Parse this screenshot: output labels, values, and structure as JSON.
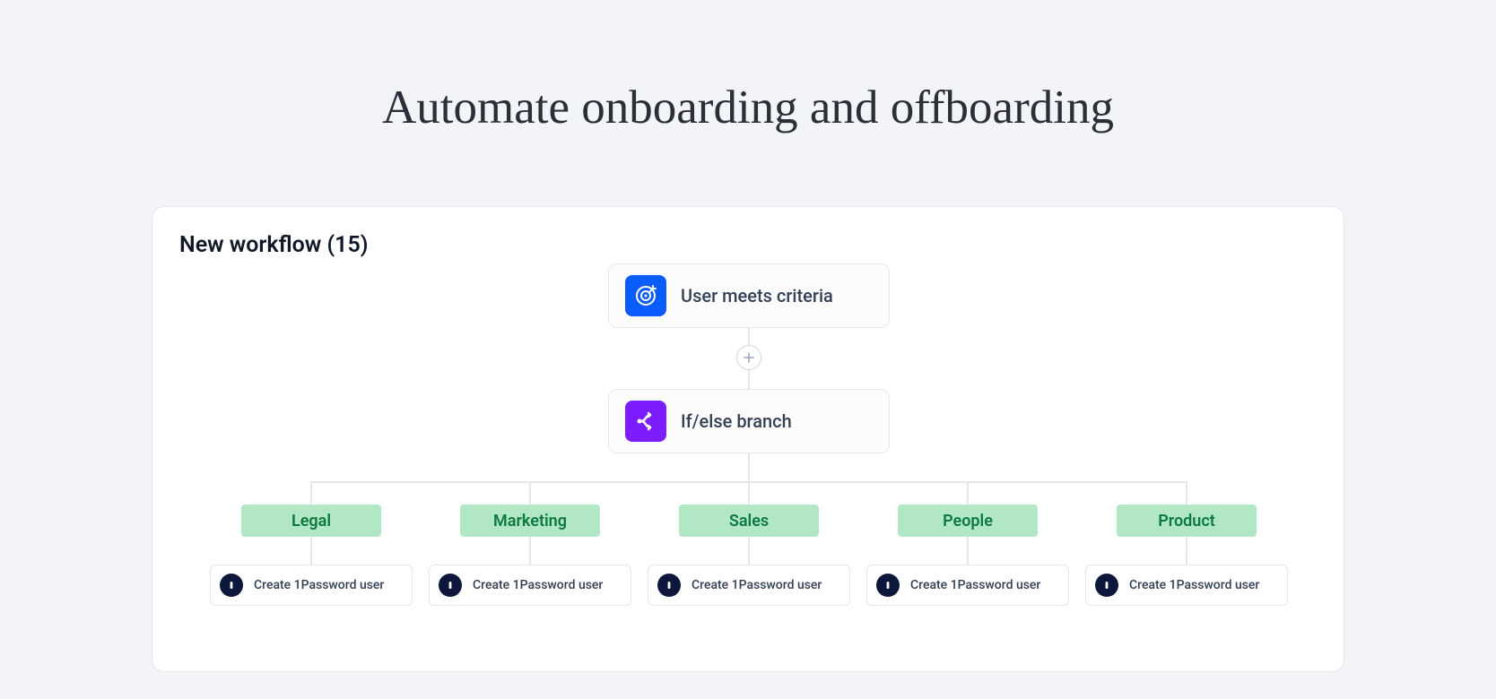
{
  "headline": "Automate onboarding and offboarding",
  "workflow": {
    "title": "New workflow (15)",
    "trigger": {
      "label": "User meets criteria",
      "icon": "target-icon"
    },
    "branch": {
      "label": "If/else branch",
      "icon": "branch-icon"
    },
    "branches": [
      {
        "name": "Legal",
        "action": "Create 1Password user"
      },
      {
        "name": "Marketing",
        "action": "Create 1Password user"
      },
      {
        "name": "Sales",
        "action": "Create 1Password user"
      },
      {
        "name": "People",
        "action": "Create 1Password user"
      },
      {
        "name": "Product",
        "action": "Create 1Password user"
      }
    ]
  },
  "colors": {
    "page_bg": "#f2f4f7",
    "card_border": "#e4e7ec",
    "trigger_icon_bg": "#0b5cff",
    "branch_icon_bg": "#7c1dff",
    "pill_bg": "#b1e7c4",
    "pill_text": "#0c7a3e",
    "action_icon_bg": "#0d173a"
  }
}
